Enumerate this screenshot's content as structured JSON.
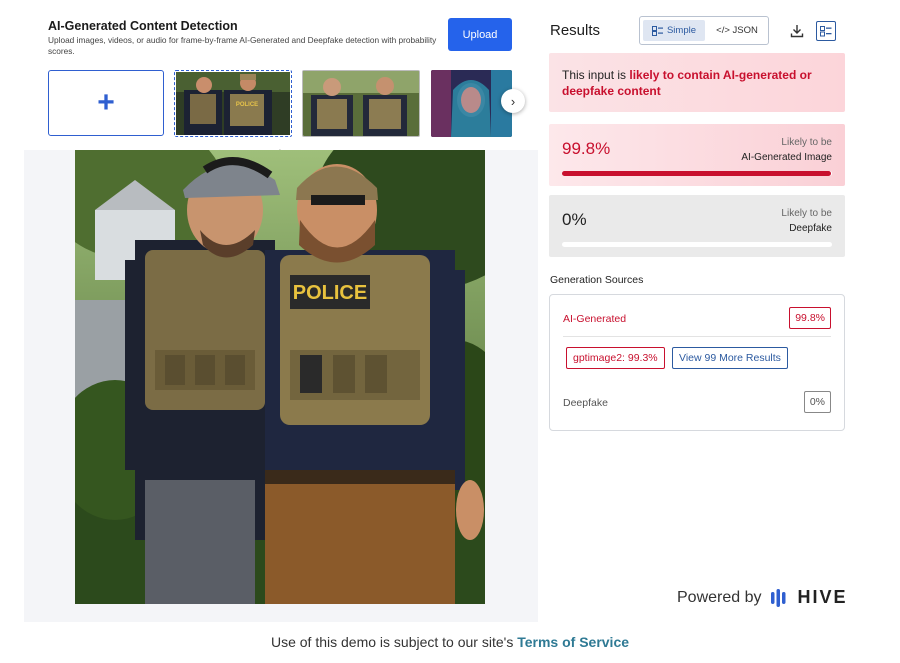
{
  "header": {
    "title": "AI-Generated Content Detection",
    "subtitle": "Upload images, videos, or audio for frame-by-frame AI-Generated and Deepfake detection with probability scores.",
    "upload_label": "Upload"
  },
  "thumbnails": {
    "add_symbol": "+",
    "next_symbol": "›",
    "items": [
      "current-image",
      "alternate-image",
      "portrait-image"
    ]
  },
  "preview": {
    "collapse_symbol": "⌃",
    "vest_text": "POLICE",
    "thumb_vest_text": "POLICE"
  },
  "results": {
    "title": "Results",
    "view_simple": "Simple",
    "view_json": "</> JSON",
    "verdict_prefix": "This input is ",
    "verdict_highlight": "likely to contain AI-generated or deepfake content",
    "ai": {
      "value": "99.8%",
      "label_top": "Likely to be",
      "label_bottom": "AI-Generated Image",
      "fraction": 0.998
    },
    "deepfake": {
      "value": "0%",
      "label_top": "Likely to be",
      "label_bottom": "Deepfake",
      "fraction": 0
    }
  },
  "generation_sources": {
    "title": "Generation Sources",
    "ai_label": "AI-Generated",
    "ai_pct": "99.8%",
    "model_chip": "gptimage2: 99.3%",
    "more_button": "View 99 More Results",
    "deepfake_label": "Deepfake",
    "deepfake_pct": "0%"
  },
  "branding": {
    "powered_by": "Powered by",
    "hive": "HIVE"
  },
  "footer": {
    "text": "Use of this demo is subject to our site's ",
    "link": "Terms of Service"
  },
  "colors": {
    "accent_blue": "#2563eb",
    "alert_red": "#c8102e",
    "link_teal": "#2f7a94"
  }
}
